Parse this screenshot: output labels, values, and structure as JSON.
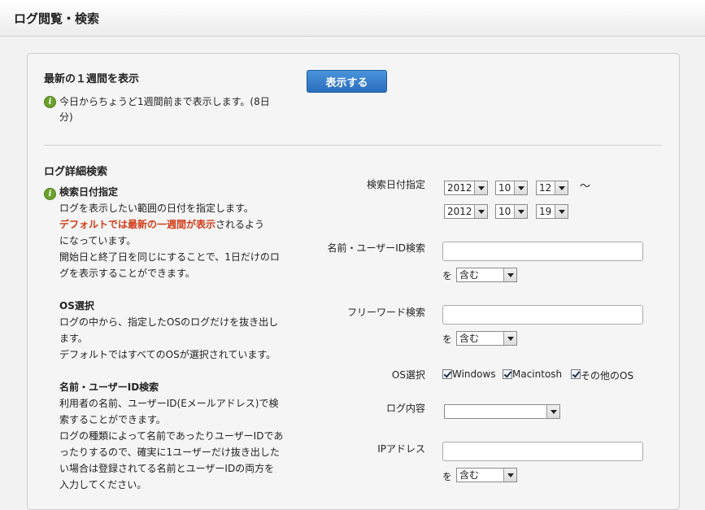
{
  "page_title": "ログ閲覧・検索",
  "recent": {
    "heading": "最新の１週間を表示",
    "note_line1": "今日からちょうど1週間前まで表示します。(8日",
    "note_line2": "分)",
    "button": "表示する"
  },
  "detail": {
    "heading": "ログ詳細検索",
    "date_help_title": "検索日付指定",
    "date_help_1": "ログを表示したい範囲の日付を指定します。",
    "date_help_red": "デフォルトでは最新の一週間が表示",
    "date_help_2": "されるよう",
    "date_help_3": "になっています。",
    "date_help_4": "開始日と終了日を同じにすることで、1日だけのロ",
    "date_help_5": "グを表示することができます。",
    "os_help_title": "OS選択",
    "os_help_1": "ログの中から、指定したOSのログだけを抜き出し",
    "os_help_2": "ます。",
    "os_help_3": "デフォルトではすべてのOSが選択されています。",
    "name_help_title": "名前・ユーザーID検索",
    "name_help_1": "利用者の名前、ユーザーID(Eメールアドレス)で検",
    "name_help_2": "索することができます。",
    "name_help_3": "ログの種類によって名前であったりユーザーIDであ",
    "name_help_4": "ったりするので、確実に1ユーザーだけ抜き出した",
    "name_help_5": "い場合は登録されてる名前とユーザーIDの両方を",
    "name_help_6": "入力してください。"
  },
  "form": {
    "date_label": "検索日付指定",
    "start": {
      "year": "2012",
      "month": "10",
      "day": "12"
    },
    "end": {
      "year": "2012",
      "month": "10",
      "day": "19"
    },
    "tilde": "～",
    "name_label": "名前・ユーザーID検索",
    "name_value": "",
    "wo": "を",
    "match_option": "含む",
    "free_label": "フリーワード検索",
    "free_value": "",
    "os_label": "OS選択",
    "os_windows": "Windows",
    "os_mac": "Macintosh",
    "os_other": "その他のOS",
    "log_content_label": "ログ内容",
    "log_content_value": "",
    "ip_label": "IPアドレス",
    "ip_value": ""
  }
}
